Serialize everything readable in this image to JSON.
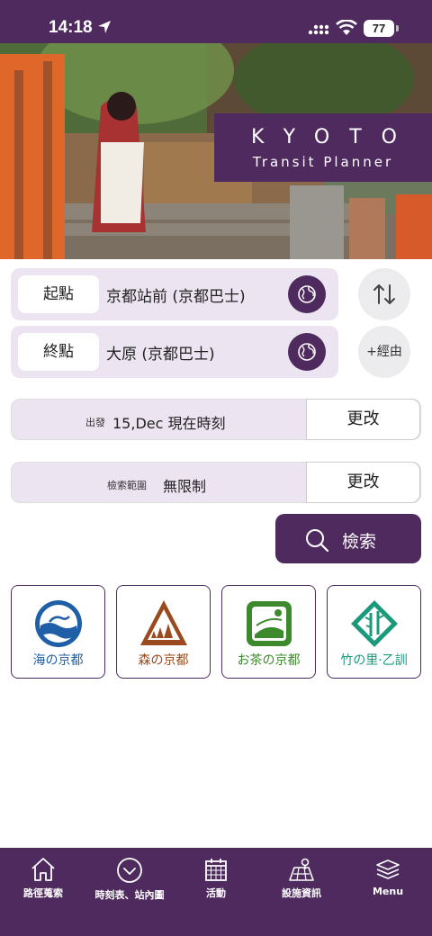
{
  "status_bar": {
    "time": "14:18",
    "battery": "77"
  },
  "hero": {
    "title": "KYOTO",
    "subtitle": "Transit Planner"
  },
  "route": {
    "origin_tag": "起點",
    "origin_station": "京都站前 (京都巴士)",
    "destination_tag": "終點",
    "destination_station": "大原 (京都巴士)",
    "via_label": "+經由"
  },
  "departure": {
    "small_label": "出發",
    "value": "15,Dec 現在時刻",
    "change_label": "更改"
  },
  "search_range": {
    "small_label": "檢索範圍",
    "value": "無限制",
    "change_label": "更改"
  },
  "search_button": {
    "label": "檢索"
  },
  "cards": [
    {
      "label": "海の京都",
      "color": "#1e5fa8"
    },
    {
      "label": "森の京都",
      "color": "#9a4a1e"
    },
    {
      "label": "お茶の京都",
      "color": "#3d8a2e"
    },
    {
      "label": "竹の里·乙訓",
      "color": "#1a9a7a"
    }
  ],
  "bottom_nav": [
    {
      "label": "路徑蒐索",
      "icon": "home-icon"
    },
    {
      "label": "時刻表、站內圖",
      "icon": "clock-icon"
    },
    {
      "label": "活動",
      "icon": "calendar-icon"
    },
    {
      "label": "設施資訊",
      "icon": "map-icon"
    },
    {
      "label": "Menu",
      "icon": "layers-icon"
    }
  ],
  "colors": {
    "brand": "#4e2a5e",
    "row_bg": "#ede4f1"
  }
}
